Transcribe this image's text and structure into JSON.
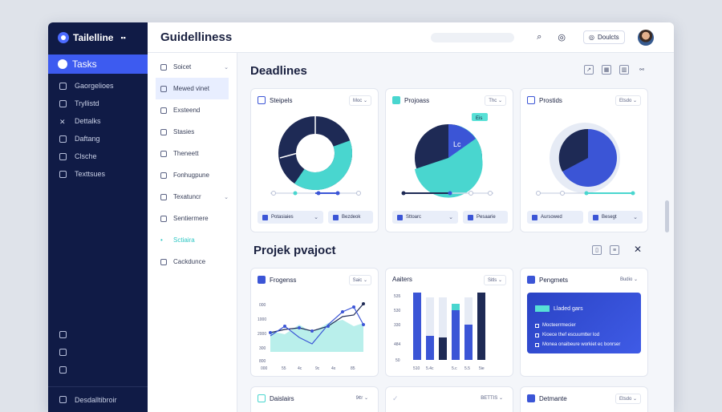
{
  "app": {
    "name": "Tailelline",
    "title": "Guidelliness",
    "tools_label": "Doulcts"
  },
  "sidebar": {
    "active": "Tasks",
    "items": [
      "Gaorgelioes",
      "Tryllistd",
      "Dettalks",
      "Daftang",
      "Clsche",
      "Texttsues"
    ],
    "user": "Desdalltibroir"
  },
  "subnav": {
    "items": [
      {
        "label": "Soicet",
        "chev": "⌄"
      },
      {
        "label": "Mewed vinet"
      },
      {
        "label": "Exsteend"
      },
      {
        "label": "Stasies"
      },
      {
        "label": "Theneett"
      },
      {
        "label": "Fonhugpune"
      },
      {
        "label": "Texatuncr",
        "chev": "⌄"
      },
      {
        "label": "Sentiermere"
      },
      {
        "label": "Sctiaira"
      },
      {
        "label": "Cackdunce"
      }
    ]
  },
  "deadlines": {
    "title": "Deadlines",
    "cards": [
      {
        "title": "Steipels",
        "dd": "Moc ⌄",
        "pill1": "Potasiaies",
        "pill2": "Bezdeok"
      },
      {
        "title": "Projoass",
        "dd": "Thc ⌄",
        "tag": "Eis",
        "inner": "Lc",
        "pill1": "Sttoarc",
        "pill2": "Pesaarie"
      },
      {
        "title": "Prostids",
        "dd": "Etsdo ⌄",
        "pill1": "Aursowed",
        "pill2": "Besegt"
      }
    ]
  },
  "project": {
    "title": "Projek pvajoct",
    "progress": {
      "title": "Frogenss",
      "dd": "Saic ⌄",
      "yticks": [
        "000",
        "1000",
        "2000",
        "300",
        "800"
      ],
      "xticks": [
        "000",
        "55",
        "4c",
        "9c",
        "4x",
        "85"
      ]
    },
    "bars": {
      "title": "Aaiters",
      "dd": "Sitls ⌄",
      "yticks": [
        "535",
        "530",
        "330",
        "484",
        "50"
      ],
      "xticks": [
        "510",
        "5.4c",
        "5.c",
        "5.5",
        "5ie"
      ]
    },
    "payments": {
      "title": "Pengmets",
      "dd": "Budio ⌄",
      "panel_title": "Lladed gars",
      "lines": [
        "Mocteerrmecier",
        "Kioece thef escuumtter lod",
        "Monea onaibeure workiet ec bonrser"
      ]
    }
  },
  "bottom": {
    "cards": [
      {
        "title": "Daislairs",
        "dd": "9¢r ⌄"
      },
      {
        "title": "",
        "dd": "BETTIS ⌄"
      },
      {
        "title": "Detmante",
        "dd": "Etsdo ⌄"
      }
    ]
  },
  "colors": {
    "navy": "#101b46",
    "accent": "#3d5bf0",
    "teal": "#49d6cf",
    "dark": "#1e2a55"
  }
}
